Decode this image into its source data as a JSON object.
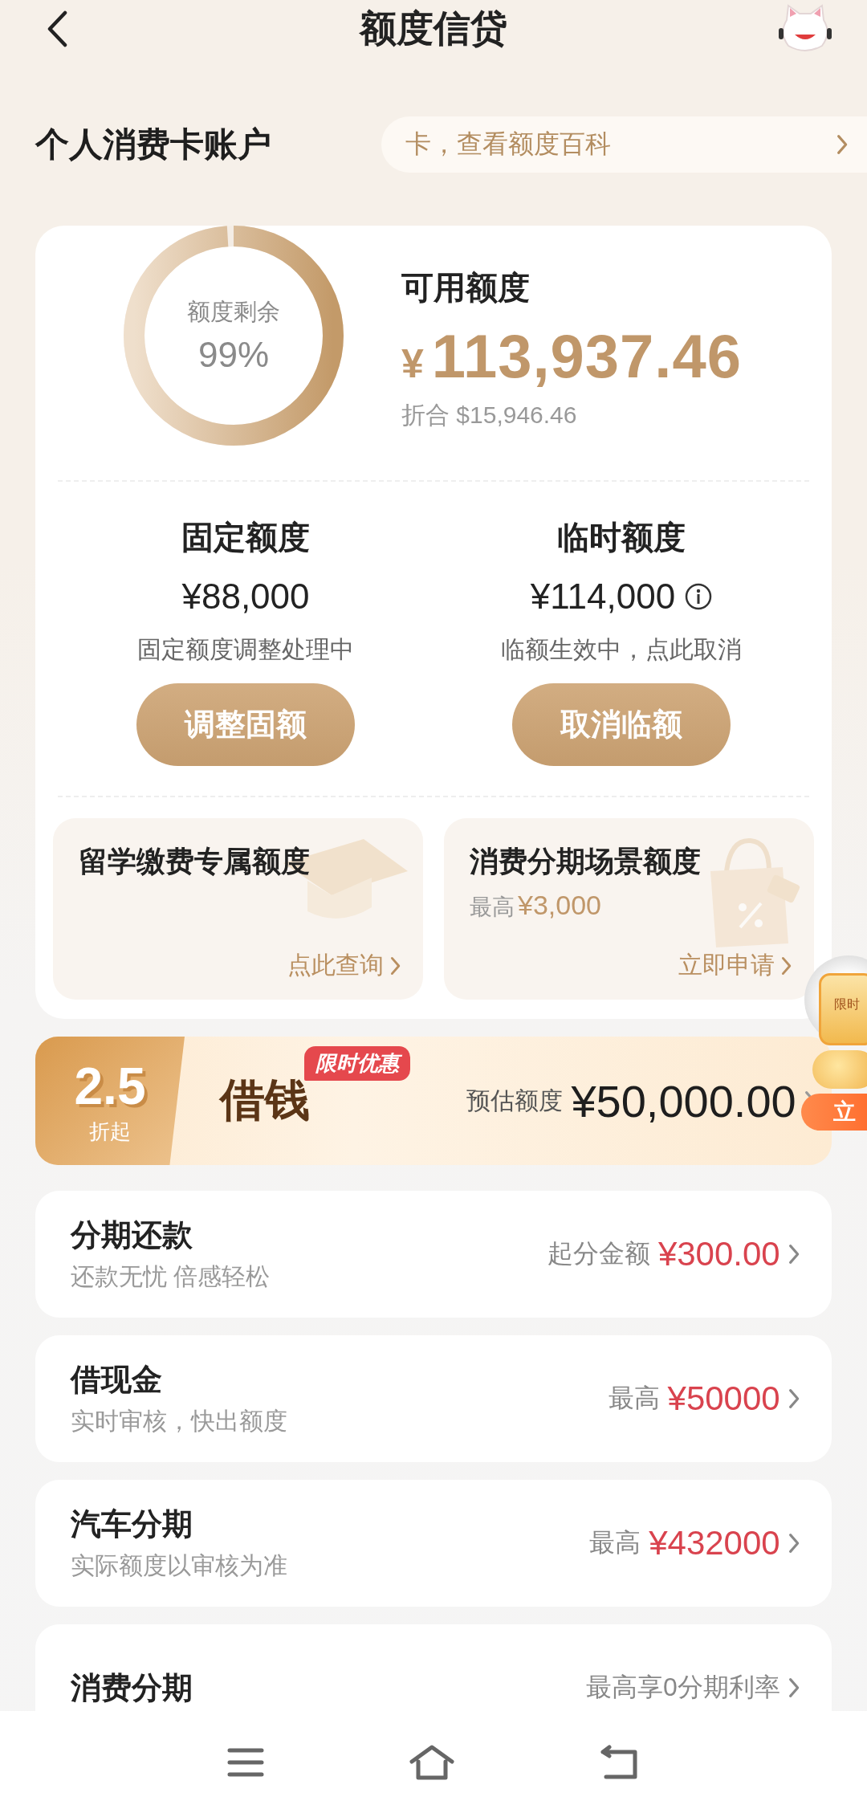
{
  "header": {
    "title": "额度信贷"
  },
  "account": {
    "title": "个人消费卡账户",
    "notice": "卡，查看额度百科"
  },
  "summary": {
    "ring_label": "额度剩余",
    "ring_value": "99%",
    "level": 0.99,
    "available_label": "可用额度",
    "currency": "¥",
    "available_amount": "113,937.46",
    "converted": "折合 $15,946.46"
  },
  "limits": [
    {
      "title": "固定额度",
      "amount": "¥88,000",
      "info": false,
      "status": "固定额度调整处理中",
      "button": "调整固额"
    },
    {
      "title": "临时额度",
      "amount": "¥114,000",
      "info": true,
      "status": "临额生效中，点此取消",
      "button": "取消临额"
    }
  ],
  "special": [
    {
      "kind": "study",
      "title": "留学缴费专属额度",
      "action": "点此查询"
    },
    {
      "kind": "shopping",
      "title": "消费分期场景额度",
      "cap_label": "最高",
      "cap_amount": "¥3,000",
      "action": "立即申请"
    }
  ],
  "loan_banner": {
    "discount": "2.5",
    "discount_unit": "折起",
    "title": "借钱",
    "tag": "限时优惠",
    "estimate_label": "预估额度",
    "estimate_amount": "¥50,000.00"
  },
  "float_promo": {
    "tag": "限时",
    "button": "立"
  },
  "products": [
    {
      "title": "分期还款",
      "subtitle": "还款无忧 倍感轻松",
      "label": "起分金额",
      "amount": "¥300.00"
    },
    {
      "title": "借现金",
      "subtitle": "实时审核，快出额度",
      "label": "最高",
      "amount": "¥50000"
    },
    {
      "title": "汽车分期",
      "subtitle": "实际额度以审核为准",
      "label": "最高",
      "amount": "¥432000"
    },
    {
      "title": "消费分期",
      "label": "最高享0分期利率"
    }
  ]
}
